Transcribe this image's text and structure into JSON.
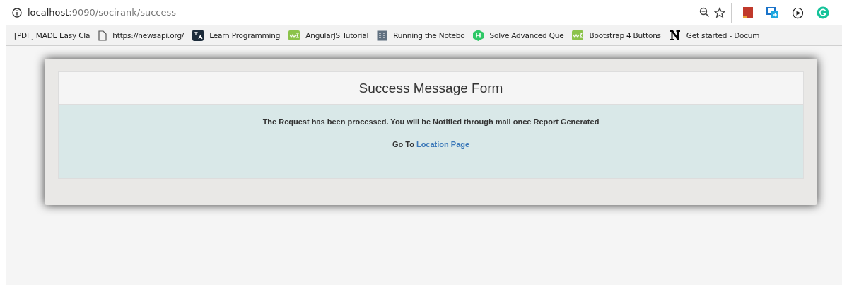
{
  "address_bar": {
    "host": "localhost",
    "path": ":9090/socirank/success"
  },
  "bookmarks": [
    {
      "label": "[PDF] MADE Easy Cla",
      "kind": "none"
    },
    {
      "label": "https://newsapi.org/",
      "kind": "page"
    },
    {
      "label": "Learn Programming",
      "kind": "translate"
    },
    {
      "label": "AngularJS Tutorial",
      "kind": "w3"
    },
    {
      "label": "Running the Notebo",
      "kind": "grid"
    },
    {
      "label": "Solve Advanced Que",
      "kind": "hex"
    },
    {
      "label": "Bootstrap 4 Buttons",
      "kind": "w3"
    },
    {
      "label": "Get started - Docum",
      "kind": "n"
    }
  ],
  "panel": {
    "title": "Success Message Form",
    "message": "The Request has been processed. You will be Notified through mail once Report Generated",
    "goto_text": "Go To",
    "link": "Location Page"
  }
}
